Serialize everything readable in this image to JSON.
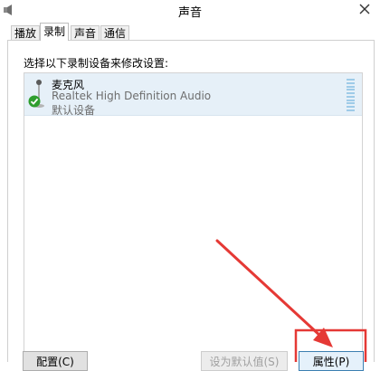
{
  "window": {
    "title": "声音",
    "close_symbol": "✕"
  },
  "tabs": [
    {
      "label": "播放",
      "active": false
    },
    {
      "label": "录制",
      "active": true
    },
    {
      "label": "声音",
      "active": false
    },
    {
      "label": "通信",
      "active": false
    }
  ],
  "recording": {
    "instruction": "选择以下录制设备来修改设置:",
    "devices": [
      {
        "name": "麦克风",
        "description": "Realtek High Definition Audio",
        "status": "默认设备",
        "icon": "microphone-icon",
        "status_icon": "check-icon"
      }
    ]
  },
  "buttons": {
    "configure": "配置(C)",
    "set_default": "设为默认值(S)",
    "properties": "属性(P)"
  },
  "colors": {
    "selection": "#e6f0f8",
    "check_green": "#2e9e2e",
    "annotation_red": "#e53935"
  }
}
